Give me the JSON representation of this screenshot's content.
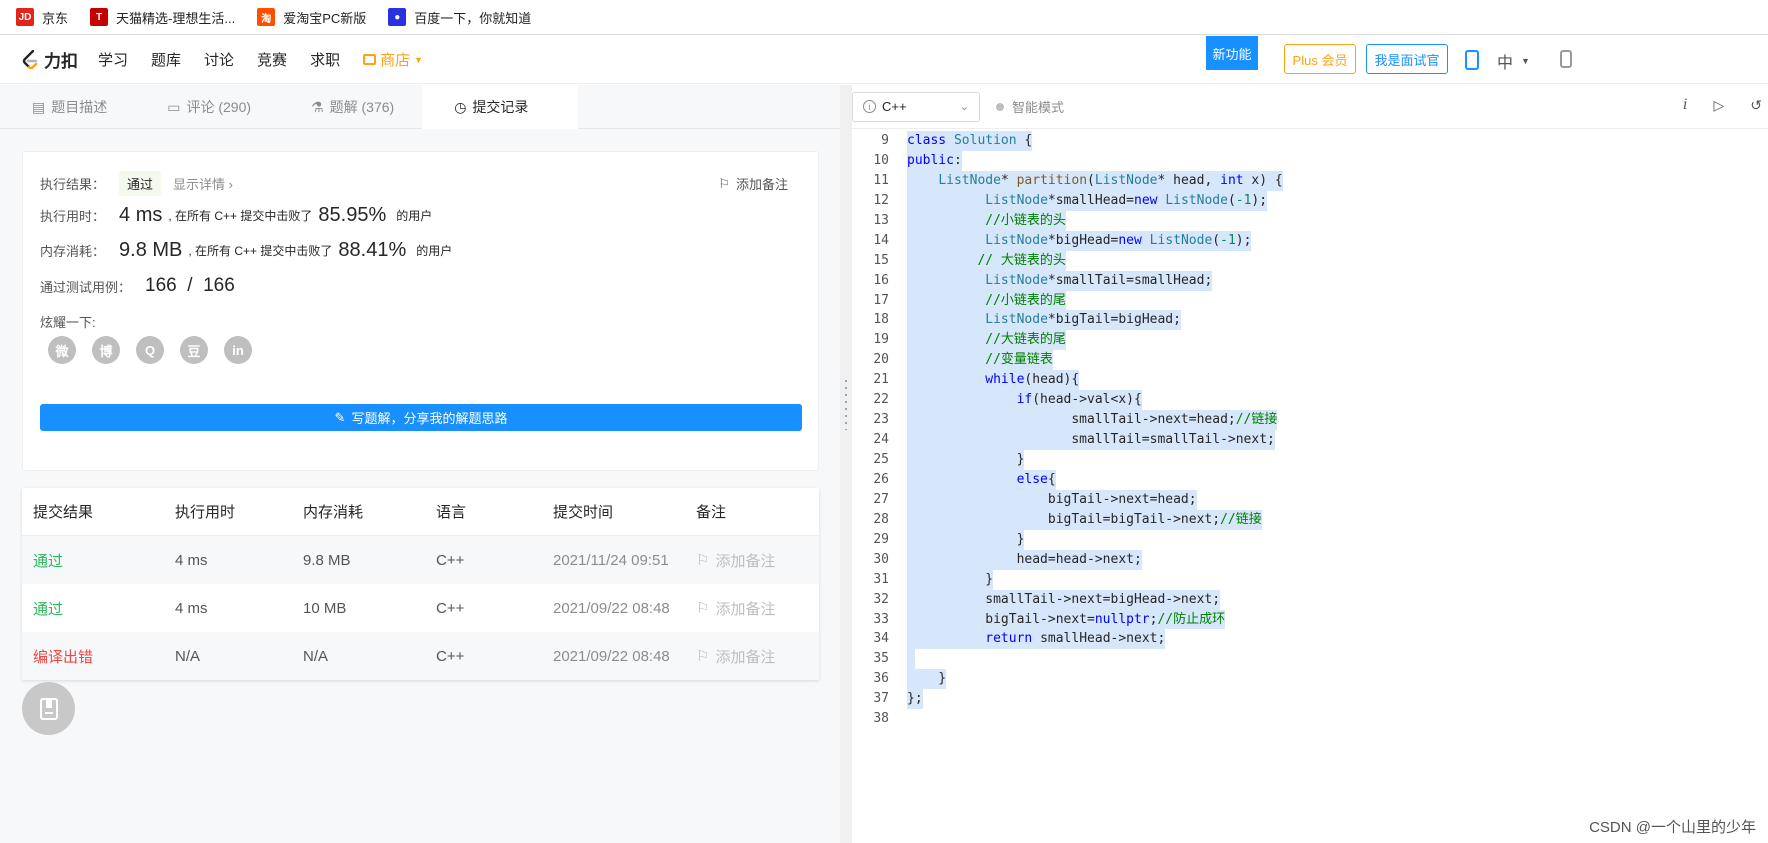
{
  "bookmarks": [
    {
      "label": "京东",
      "icon": "jd-icon",
      "color": "#e1251b",
      "glyph": "JD"
    },
    {
      "label": "天猫精选-理想生活...",
      "icon": "tmall-icon",
      "color": "#c40000",
      "glyph": "T"
    },
    {
      "label": "爱淘宝PC新版",
      "icon": "taobao-icon",
      "color": "#ff5000",
      "glyph": "淘"
    },
    {
      "label": "百度一下，你就知道",
      "icon": "baidu-icon",
      "color": "#2932e1",
      "glyph": "●"
    }
  ],
  "nav": {
    "logo": "力扣",
    "items": [
      "学习",
      "题库",
      "讨论",
      "竞赛",
      "求职"
    ],
    "shop": "商店",
    "new_feature": "新功能",
    "plus": "Plus 会员",
    "interviewer": "我是面试官",
    "lang": "中"
  },
  "tabs": [
    {
      "label": "题目描述",
      "icon": "document-icon"
    },
    {
      "label": "评论 (290)",
      "icon": "comment-icon"
    },
    {
      "label": "题解 (376)",
      "icon": "flask-icon"
    },
    {
      "label": "提交记录",
      "icon": "clock-icon",
      "active": true
    }
  ],
  "result": {
    "status_label": "执行结果：",
    "status": "通过",
    "show_detail": "显示详情 ›",
    "add_note": "添加备注",
    "runtime_label": "执行用时：",
    "runtime_value": "4 ms",
    "runtime_mid": ", 在所有 C++ 提交中击败了",
    "runtime_pct": "85.95%",
    "runtime_suffix": "的用户",
    "memory_label": "内存消耗：",
    "memory_value": "9.8 MB",
    "memory_mid": ", 在所有 C++ 提交中击败了",
    "memory_pct": "88.41%",
    "memory_suffix": "的用户",
    "tests_label": "通过测试用例：",
    "tests_value": "166  /  166",
    "share_label": "炫耀一下:",
    "share_icons": [
      {
        "name": "wechat-icon",
        "glyph": "微"
      },
      {
        "name": "weibo-icon",
        "glyph": "博"
      },
      {
        "name": "qq-icon",
        "glyph": "Q"
      },
      {
        "name": "douban-icon",
        "glyph": "豆"
      },
      {
        "name": "linkedin-icon",
        "glyph": "in"
      }
    ],
    "write_button": "写题解，分享我的解题思路"
  },
  "submissions": {
    "headers": [
      "提交结果",
      "执行用时",
      "内存消耗",
      "语言",
      "提交时间",
      "备注"
    ],
    "rows": [
      {
        "status": "通过",
        "time": "4 ms",
        "memory": "9.8 MB",
        "lang": "C++",
        "submitted": "2021/11/24 09:51",
        "note": "添加备注",
        "ok": true
      },
      {
        "status": "通过",
        "time": "4 ms",
        "memory": "10 MB",
        "lang": "C++",
        "submitted": "2021/09/22 08:48",
        "note": "添加备注",
        "ok": true
      },
      {
        "status": "编译出错",
        "time": "N/A",
        "memory": "N/A",
        "lang": "C++",
        "submitted": "2021/09/22 08:48",
        "note": "添加备注",
        "ok": false
      }
    ]
  },
  "editor": {
    "language": "C++",
    "smart_mode": "智能模式",
    "lines": [
      {
        "n": "9",
        "code": "class Solution {"
      },
      {
        "n": "10",
        "code": "public:"
      },
      {
        "n": "11",
        "code": "    ListNode* partition(ListNode* head, int x) {"
      },
      {
        "n": "12",
        "code": "          ListNode*smallHead=new ListNode(-1);"
      },
      {
        "n": "13",
        "code": "          //小链表的头"
      },
      {
        "n": "14",
        "code": "          ListNode*bigHead=new ListNode(-1);"
      },
      {
        "n": "15",
        "code": "         // 大链表的头"
      },
      {
        "n": "16",
        "code": "          ListNode*smallTail=smallHead;"
      },
      {
        "n": "17",
        "code": "          //小链表的尾"
      },
      {
        "n": "18",
        "code": "          ListNode*bigTail=bigHead;"
      },
      {
        "n": "19",
        "code": "          //大链表的尾"
      },
      {
        "n": "20",
        "code": "          //变量链表"
      },
      {
        "n": "21",
        "code": "          while(head){"
      },
      {
        "n": "22",
        "code": "              if(head->val<x){"
      },
      {
        "n": "23",
        "code": "                     smallTail->next=head;//链接"
      },
      {
        "n": "24",
        "code": "                     smallTail=smallTail->next;"
      },
      {
        "n": "25",
        "code": "              }"
      },
      {
        "n": "26",
        "code": "              else{"
      },
      {
        "n": "27",
        "code": "                  bigTail->next=head;"
      },
      {
        "n": "28",
        "code": "                  bigTail=bigTail->next;//链接"
      },
      {
        "n": "29",
        "code": "              }"
      },
      {
        "n": "30",
        "code": "              head=head->next;"
      },
      {
        "n": "31",
        "code": "          }"
      },
      {
        "n": "32",
        "code": "          smallTail->next=bigHead->next;"
      },
      {
        "n": "33",
        "code": "          bigTail->next=nullptr;//防止成环"
      },
      {
        "n": "34",
        "code": "          return smallHead->next;"
      },
      {
        "n": "35",
        "code": " "
      },
      {
        "n": "36",
        "code": "    }"
      },
      {
        "n": "37",
        "code": "};"
      },
      {
        "n": "38",
        "code": ""
      }
    ]
  },
  "watermark": "CSDN @一个山里的少年"
}
